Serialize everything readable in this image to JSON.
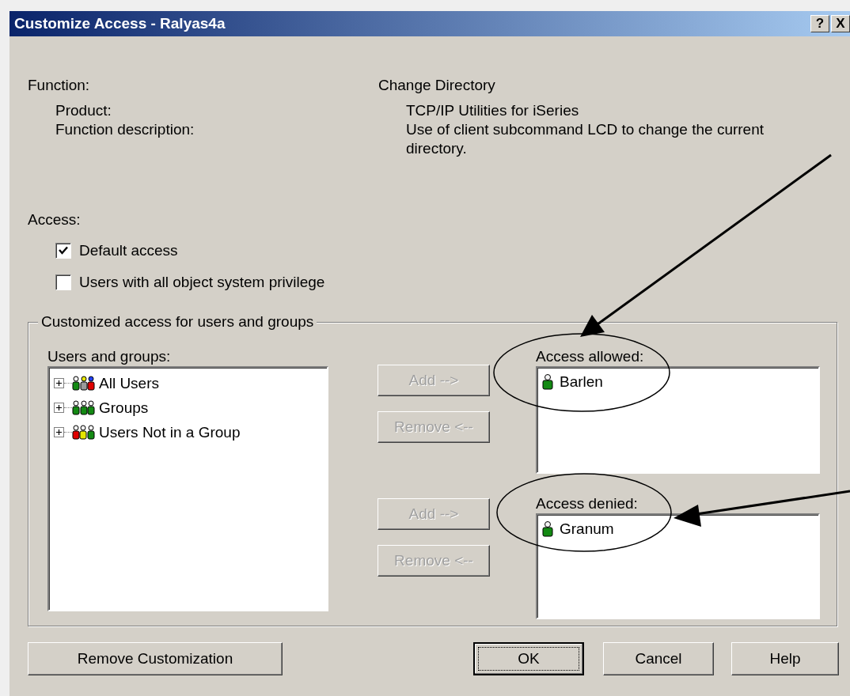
{
  "window": {
    "title": "Customize Access - Ralyas4a",
    "help_button": "?",
    "close_button": "X"
  },
  "function": {
    "label": "Function:",
    "value": "Change Directory"
  },
  "fields": [
    {
      "label": "Product:",
      "value": "TCP/IP Utilities for iSeries"
    },
    {
      "label": "Function description:",
      "value": "Use of client subcommand LCD to change the current directory."
    }
  ],
  "access": {
    "label": "Access:",
    "options": [
      {
        "label": "Default access",
        "checked": true
      },
      {
        "label": "Users with all object system privilege",
        "checked": false
      }
    ]
  },
  "customized": {
    "title": "Customized access for users and groups",
    "users_and_groups": {
      "label": "Users and groups:",
      "items": [
        {
          "label": "All Users",
          "kind": "all",
          "expanded": false
        },
        {
          "label": "Groups",
          "kind": "groups",
          "expanded": false
        },
        {
          "label": "Users Not in a Group",
          "kind": "ungrouped",
          "expanded": false
        }
      ]
    },
    "lists": [
      {
        "label": "Access allowed:",
        "users": [
          "Barlen"
        ],
        "buttons": [
          {
            "label": "Add -->",
            "disabled": true
          },
          {
            "label": "Remove <--",
            "disabled": true
          }
        ]
      },
      {
        "label": "Access denied:",
        "users": [
          "Granum"
        ],
        "buttons": [
          {
            "label": "Add -->",
            "disabled": true
          },
          {
            "label": "Remove <--",
            "disabled": true
          }
        ]
      }
    ]
  },
  "buttons": [
    {
      "label": "Remove Customization",
      "focused": false
    },
    {
      "label": "OK",
      "focused": true
    },
    {
      "label": "Cancel",
      "focused": false
    },
    {
      "label": "Help",
      "focused": false
    }
  ]
}
